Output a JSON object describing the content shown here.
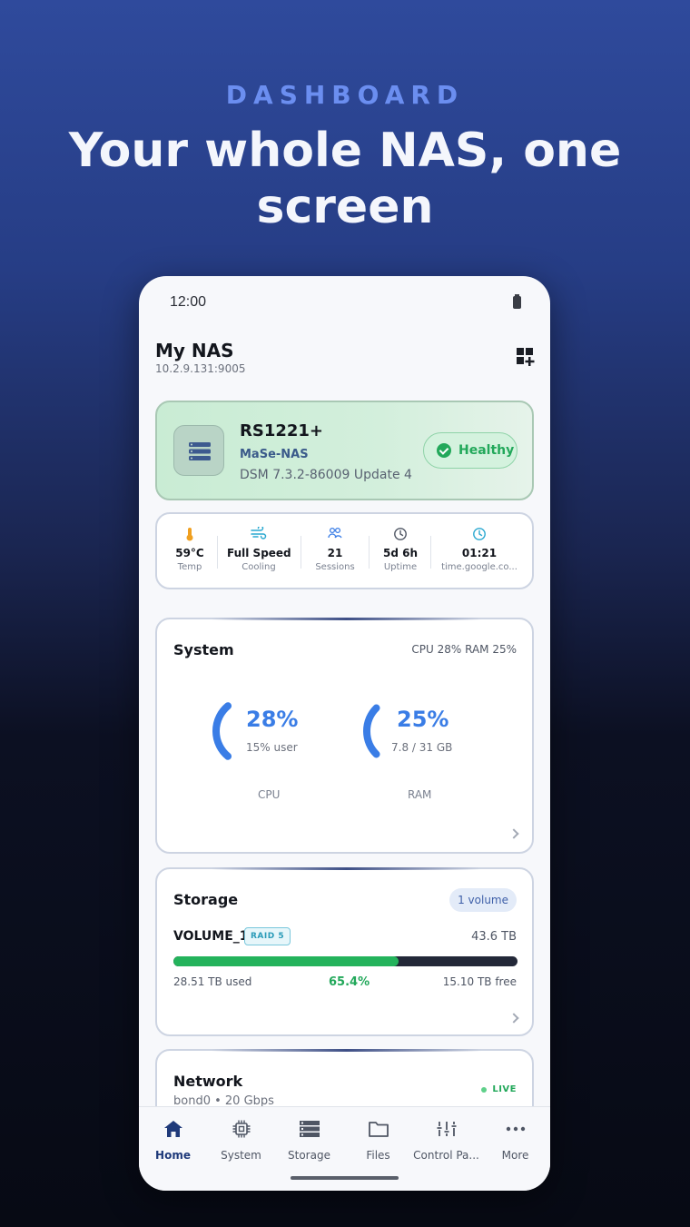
{
  "hero": {
    "eyebrow": "DASHBOARD",
    "headline": "Your whole NAS, one screen"
  },
  "status_bar": {
    "time": "12:00"
  },
  "app": {
    "title": "My NAS",
    "address": "10.2.9.131:9005"
  },
  "device": {
    "model": "RS1221+",
    "hostname": "MaSe-NAS",
    "dsm": "DSM 7.3.2-86009 Update 4",
    "health": "Healthy"
  },
  "stats": [
    {
      "icon": "thermometer-icon",
      "value": "59°C",
      "label": "Temp"
    },
    {
      "icon": "fan-wind-icon",
      "value": "Full Speed",
      "label": "Cooling"
    },
    {
      "icon": "users-icon",
      "value": "21",
      "label": "Sessions"
    },
    {
      "icon": "clock-icon",
      "value": "5d 6h",
      "label": "Uptime"
    },
    {
      "icon": "time-sync-icon",
      "value": "01:21",
      "label": "time.google.co..."
    }
  ],
  "system": {
    "title": "System",
    "summary": "CPU 28%  RAM 25%",
    "cpu": {
      "percent": "28%",
      "detail": "15% user",
      "label": "CPU",
      "fraction": 0.28
    },
    "ram": {
      "percent": "25%",
      "detail": "7.8 / 31 GB",
      "label": "RAM",
      "fraction": 0.25
    }
  },
  "storage": {
    "title": "Storage",
    "badge": "1 volume",
    "volume_name": "VOLUME_1",
    "raid": "RAID 5",
    "size": "43.6 TB",
    "used": "28.51 TB used",
    "percent": "65.4%",
    "used_fraction": 0.654,
    "free": "15.10 TB free"
  },
  "network": {
    "title": "Network",
    "subtitle": "bond0 • 20 Gbps",
    "status": "LIVE"
  },
  "nav": [
    {
      "label": "Home",
      "icon": "home-icon",
      "active": true
    },
    {
      "label": "System",
      "icon": "chip-icon"
    },
    {
      "label": "Storage",
      "icon": "storage-icon"
    },
    {
      "label": "Files",
      "icon": "folder-icon"
    },
    {
      "label": "Control Pa...",
      "icon": "sliders-icon"
    },
    {
      "label": "More",
      "icon": "more-dots-icon"
    }
  ],
  "colors": {
    "accent": "#3a7de6",
    "healthy": "#22a85a",
    "brand_dark": "#1f3a7a"
  }
}
